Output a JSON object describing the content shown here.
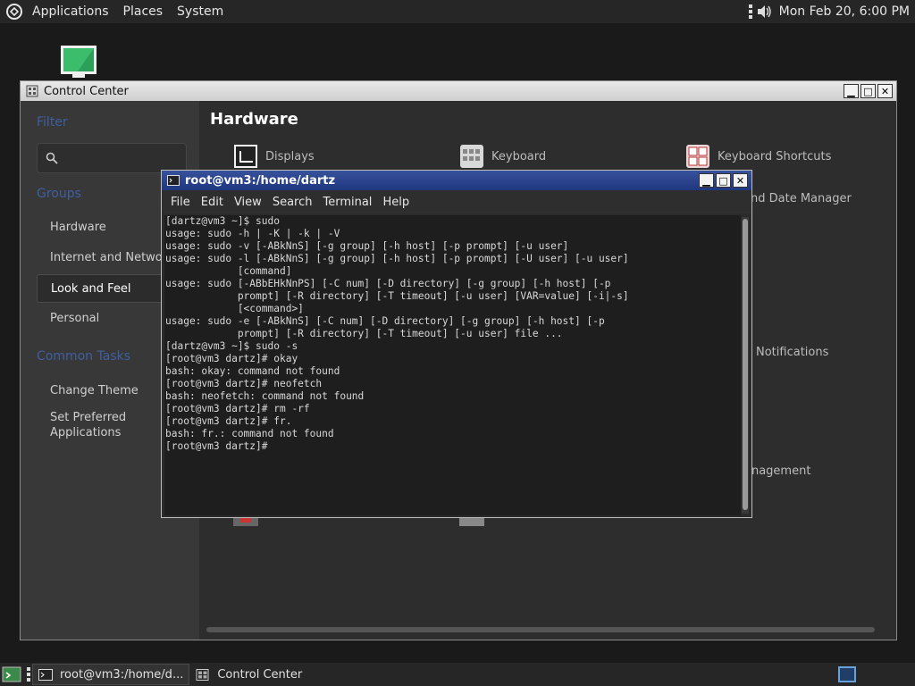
{
  "top_panel": {
    "menus": [
      "Applications",
      "Places",
      "System"
    ],
    "clock": "Mon Feb 20,  6:00 PM"
  },
  "control_center": {
    "title": "Control Center",
    "sidebar": {
      "filter_heading": "Filter",
      "groups_heading": "Groups",
      "groups": [
        "Hardware",
        "Internet and Network",
        "Look and Feel",
        "Personal"
      ],
      "selected_group": "Look and Feel",
      "common_tasks_heading": "Common Tasks",
      "tasks": [
        "Change Theme",
        "Set Preferred Applications"
      ]
    },
    "main": {
      "section_title": "Hardware",
      "apps": [
        "Displays",
        "Keyboard",
        "Keyboard Shortcuts"
      ],
      "partial_labels": [
        "nd Date Manager",
        "Notifications",
        "anagement"
      ]
    }
  },
  "terminal": {
    "title": "root@vm3:/home/dartz",
    "menu": [
      "File",
      "Edit",
      "View",
      "Search",
      "Terminal",
      "Help"
    ],
    "lines": [
      "[dartz@vm3 ~]$ sudo",
      "usage: sudo -h | -K | -k | -V",
      "usage: sudo -v [-ABkNnS] [-g group] [-h host] [-p prompt] [-u user]",
      "usage: sudo -l [-ABkNnS] [-g group] [-h host] [-p prompt] [-U user] [-u user]",
      "            [command]",
      "usage: sudo [-ABbEHkNnPS] [-C num] [-D directory] [-g group] [-h host] [-p",
      "            prompt] [-R directory] [-T timeout] [-u user] [VAR=value] [-i|-s]",
      "            [<command>]",
      "usage: sudo -e [-ABkNnS] [-C num] [-D directory] [-g group] [-h host] [-p",
      "            prompt] [-R directory] [-T timeout] [-u user] file ...",
      "[dartz@vm3 ~]$ sudo -s",
      "[root@vm3 dartz]# okay",
      "bash: okay: command not found",
      "[root@vm3 dartz]# neofetch",
      "bash: neofetch: command not found",
      "[root@vm3 dartz]# rm -rf",
      "[root@vm3 dartz]# fr.",
      "bash: fr.: command not found",
      "[root@vm3 dartz]#"
    ]
  },
  "taskbar": {
    "tasks": [
      "root@vm3:/home/d...",
      "Control Center"
    ]
  },
  "colors": {
    "panel_bg": "#262626",
    "terminal_title_bg": "#2b4590",
    "heading_blue": "#3f5f9f"
  }
}
